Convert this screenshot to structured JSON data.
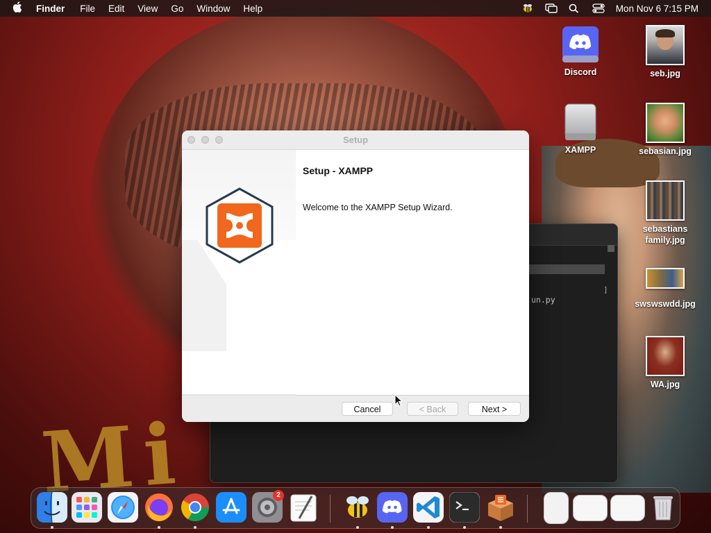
{
  "menubar": {
    "app_name": "Finder",
    "menus": [
      "File",
      "Edit",
      "View",
      "Go",
      "Window",
      "Help"
    ],
    "clock": "Mon Nov 6  7:15 PM"
  },
  "desktop": {
    "icons": [
      {
        "label": "Discord",
        "kind": "disk"
      },
      {
        "label": "seb.jpg",
        "kind": "photo"
      },
      {
        "label": "XAMPP",
        "kind": "disk"
      },
      {
        "label": "sebasian.jpg",
        "kind": "photo"
      },
      {
        "label": "sebastians family.jpg",
        "kind": "photo"
      },
      {
        "label": "swswswdd.jpg",
        "kind": "photo"
      },
      {
        "label": "WA.jpg",
        "kind": "photo"
      }
    ]
  },
  "background_window": {
    "code_text": "un.py",
    "bracket": "]"
  },
  "setup_dialog": {
    "title": "Setup",
    "heading": "Setup - XAMPP",
    "welcome": "Welcome to the XAMPP Setup Wizard.",
    "buttons": {
      "cancel": "Cancel",
      "back": "< Back",
      "next": "Next >"
    },
    "back_enabled": false
  },
  "dock": {
    "apps": [
      "Finder",
      "Launchpad",
      "Safari",
      "Firefox",
      "Chrome",
      "App Store",
      "System Settings",
      "TextEdit",
      "Bee",
      "Discord",
      "VS Code",
      "Terminal",
      "XAMPP Installer"
    ],
    "settings_badge": "2"
  },
  "colors": {
    "xampp_orange": "#f0671d",
    "xampp_navy": "#27384e",
    "badge_red": "#e5332a"
  }
}
